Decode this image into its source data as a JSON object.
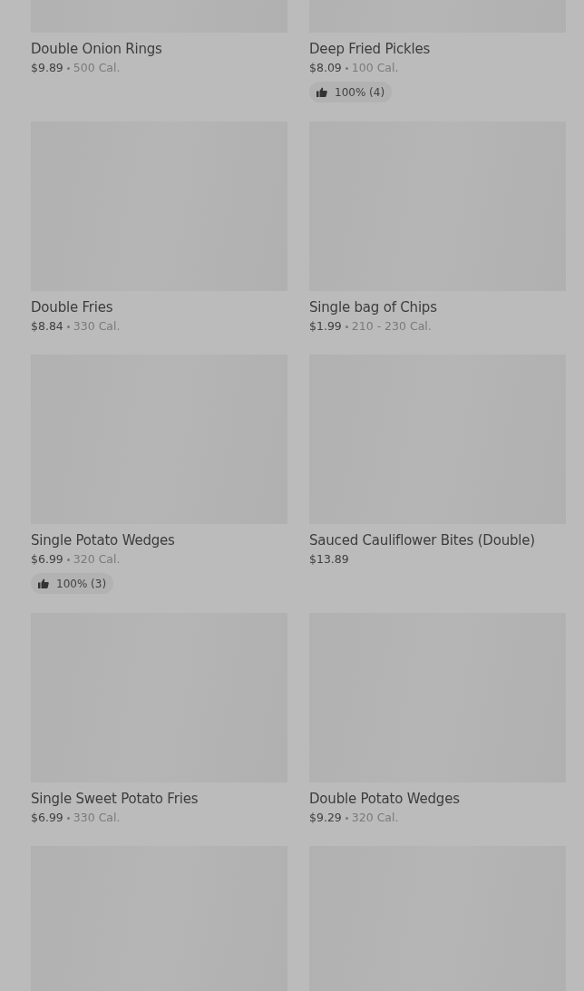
{
  "items": [
    {
      "kind": "placeholder",
      "name": "Double Onion Rings",
      "price": "$9.89",
      "calories": "500 Cal."
    },
    {
      "kind": "placeholder",
      "name": "Deep Fried Pickles",
      "price": "$8.09",
      "calories": "100 Cal.",
      "rating": "100% (4)"
    },
    {
      "kind": "placeholder",
      "name": "Double Fries",
      "price": "$8.84",
      "calories": "330 Cal."
    },
    {
      "kind": "placeholder",
      "name": "Single bag of Chips",
      "price": "$1.99",
      "calories": "210 - 230 Cal."
    },
    {
      "kind": "placeholder",
      "name": "Single Potato Wedges",
      "price": "$6.99",
      "calories": "320 Cal.",
      "rating": "100% (3)"
    },
    {
      "kind": "placeholder",
      "name": "Sauced Cauliflower Bites (Double)",
      "price": "$13.89"
    },
    {
      "kind": "placeholder",
      "name": "Single Sweet Potato Fries",
      "price": "$6.99",
      "calories": "330 Cal."
    },
    {
      "kind": "placeholder",
      "name": "Double Potato Wedges",
      "price": "$9.29",
      "calories": "320 Cal."
    },
    {
      "kind": "placeholder"
    },
    {
      "kind": "placeholder"
    }
  ]
}
